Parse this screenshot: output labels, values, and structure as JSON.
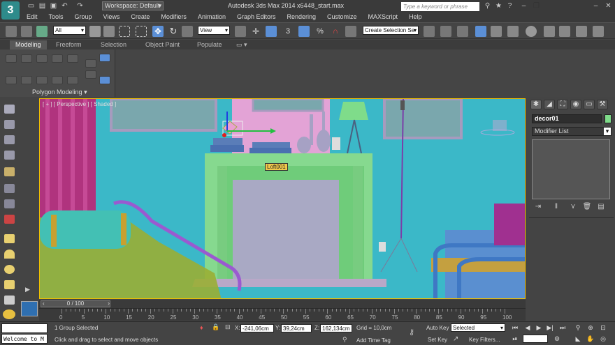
{
  "title_bar": {
    "workspace": "Workspace: Default",
    "app_title": "Autodesk 3ds Max  2014 x64",
    "file_name": "48_start.max",
    "search_placeholder": "Type a keyword or phrase"
  },
  "menu": [
    "Edit",
    "Tools",
    "Group",
    "Views",
    "Create",
    "Modifiers",
    "Animation",
    "Graph Editors",
    "Rendering",
    "Customize",
    "MAXScript",
    "Help"
  ],
  "toolbar": {
    "selection_filter": "All",
    "ref_coord": "View",
    "selection_set": "Create Selection Se"
  },
  "ribbon": {
    "tabs": [
      "Modeling",
      "Freeform",
      "Selection",
      "Object Paint",
      "Populate"
    ],
    "active_tab": "Modeling",
    "panel_label": "Polygon Modeling"
  },
  "viewport": {
    "label": "[ + ] [ Perspective ] [ Shaded ]",
    "object_tooltip": "Loft001",
    "colors": {
      "background": "#3bb8c8",
      "wall_pink": "#e3a3d6",
      "fireplace_green": "#86d98f",
      "selection_border": "#f0c000"
    }
  },
  "command_panel": {
    "object_name": "decor01",
    "modifier_list": "Modifier List",
    "object_color": "#7fdc8a"
  },
  "time_slider": {
    "position": "0 / 100",
    "ticks": [
      "0",
      "5",
      "10",
      "15",
      "20",
      "25",
      "30",
      "35",
      "40",
      "45",
      "50",
      "55",
      "60",
      "65",
      "70",
      "75",
      "80",
      "85",
      "90",
      "95",
      "100"
    ]
  },
  "status": {
    "welcome": "Welcome to M",
    "selection_info": "1 Group Selected",
    "prompt": "Click and drag to select and move objects",
    "x_label": "X:",
    "x": "-241,06cm",
    "y_label": "Y:",
    "y": "39,24cm",
    "z_label": "Z:",
    "z": "162,134cm",
    "grid": "Grid = 10,0cm",
    "add_time_tag": "Add Time Tag",
    "auto_key": "Auto Key",
    "set_key": "Set Key",
    "key_mode": "Selected",
    "key_filters": "Key Filters..."
  }
}
